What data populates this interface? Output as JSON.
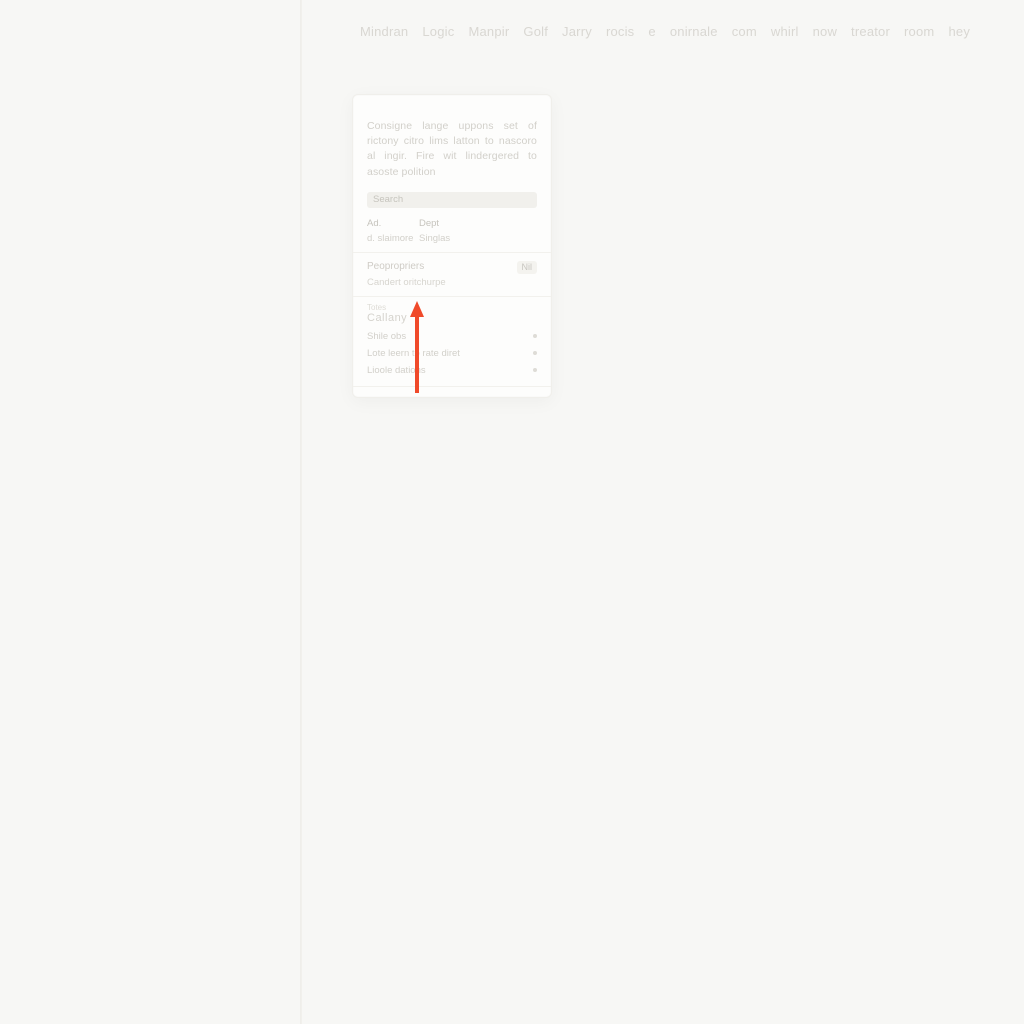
{
  "topbar": {
    "items": [
      "Mindran",
      "Logic",
      "Manpir",
      "Golf",
      "Jarry",
      "rocis",
      "e",
      "onirnale",
      "com",
      "whirl",
      "now",
      "treator",
      "room",
      "hey"
    ]
  },
  "card": {
    "description": "Consigne lange uppons set of rictony citro lims latton to nascoro al ingir. Fire wit lindergered to asoste polition",
    "search_placeholder": "Search",
    "header": {
      "col1": "Ad.",
      "col2": "Dept"
    },
    "subheader": {
      "col1": "d. slaimore",
      "col2": "Singlas"
    },
    "entry": {
      "title": "Peopropriers",
      "badge": "Nil",
      "subtitle": "Candert oritchurpe"
    },
    "section_label": "Totes",
    "section_title": "Callany",
    "options": [
      "Shile obs",
      "Lote leern to rate diret",
      "Lioole dations"
    ]
  },
  "colors": {
    "arrow": "#f04a2a"
  }
}
